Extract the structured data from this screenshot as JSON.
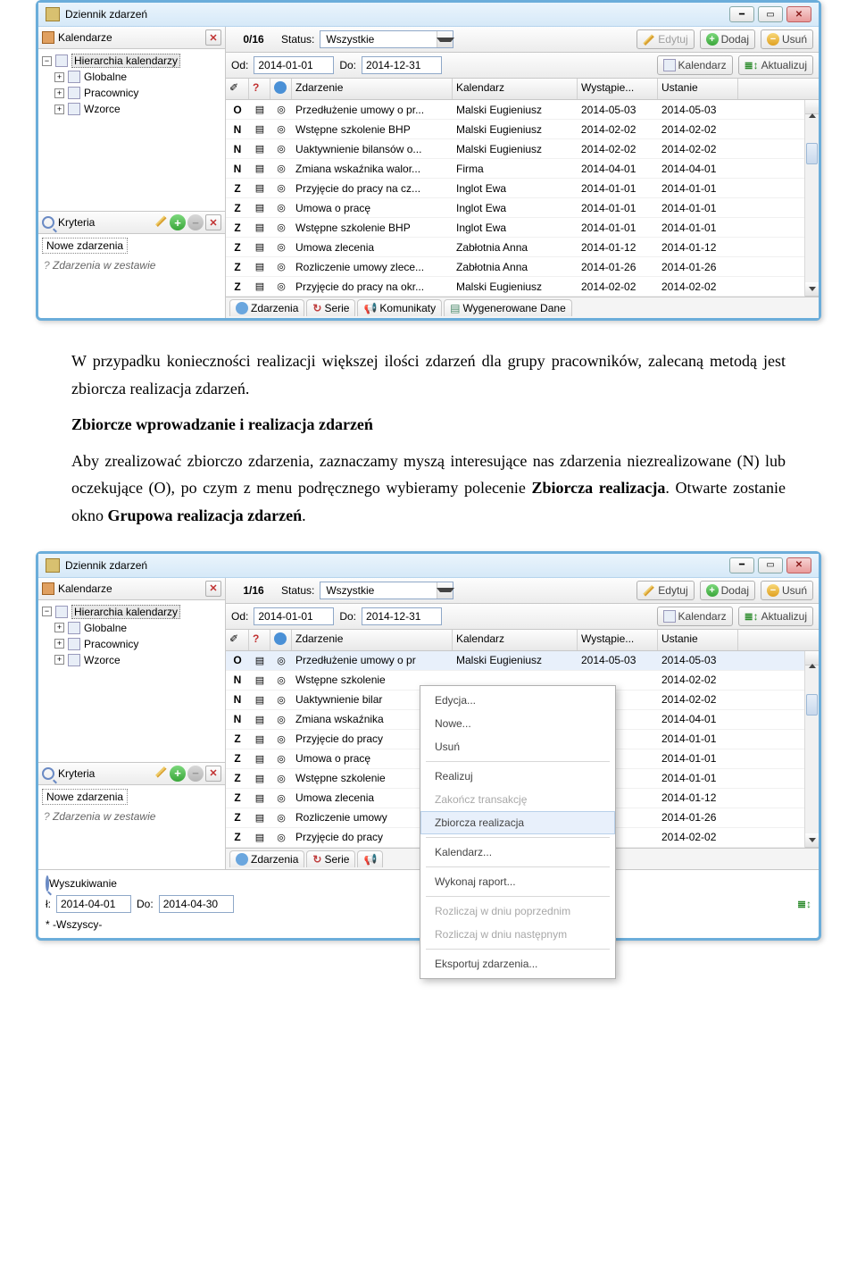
{
  "window_title": "Dziennik zdarzeń",
  "left": {
    "calendars_label": "Kalendarze",
    "tree_root": "Hierarchia kalendarzy",
    "tree_items": [
      "Globalne",
      "Pracownicy",
      "Wzorce"
    ],
    "criteria_label": "Kryteria",
    "criteria_box": "Nowe zdarzenia",
    "criteria_note": "Zdarzenia w zestawie"
  },
  "toolbar": {
    "counter1": "0/16",
    "counter2": "1/16",
    "status_label": "Status:",
    "status_value": "Wszystkie",
    "edit": "Edytuj",
    "add": "Dodaj",
    "del": "Usuń",
    "od": "Od:",
    "do": "Do:",
    "date_from": "2014-01-01",
    "date_to": "2014-12-31",
    "kalendarz": "Kalendarz",
    "aktualizuj": "Aktualizuj"
  },
  "grid": {
    "cols": {
      "c1": "Zdarzenie",
      "c2": "Kalendarz",
      "c3": "Wystąpie...",
      "c4": "Ustanie"
    },
    "rows": [
      {
        "s": "O",
        "ev": "Przedłużenie umowy o pr...",
        "kal": "Malski Eugieniusz",
        "d1": "2014-05-03",
        "d2": "2014-05-03"
      },
      {
        "s": "N",
        "ev": "Wstępne szkolenie BHP",
        "kal": "Malski Eugieniusz",
        "d1": "2014-02-02",
        "d2": "2014-02-02"
      },
      {
        "s": "N",
        "ev": "Uaktywnienie bilansów o...",
        "kal": "Malski Eugieniusz",
        "d1": "2014-02-02",
        "d2": "2014-02-02"
      },
      {
        "s": "N",
        "ev": "Zmiana wskaźnika walor...",
        "kal": "Firma",
        "d1": "2014-04-01",
        "d2": "2014-04-01"
      },
      {
        "s": "Z",
        "ev": "Przyjęcie do pracy na cz...",
        "kal": "Inglot Ewa",
        "d1": "2014-01-01",
        "d2": "2014-01-01"
      },
      {
        "s": "Z",
        "ev": "Umowa o pracę",
        "kal": "Inglot Ewa",
        "d1": "2014-01-01",
        "d2": "2014-01-01"
      },
      {
        "s": "Z",
        "ev": "Wstępne szkolenie BHP",
        "kal": "Inglot Ewa",
        "d1": "2014-01-01",
        "d2": "2014-01-01"
      },
      {
        "s": "Z",
        "ev": "Umowa zlecenia",
        "kal": "Zabłotnia Anna",
        "d1": "2014-01-12",
        "d2": "2014-01-12"
      },
      {
        "s": "Z",
        "ev": "Rozliczenie umowy zlece...",
        "kal": "Zabłotnia Anna",
        "d1": "2014-01-26",
        "d2": "2014-01-26"
      },
      {
        "s": "Z",
        "ev": "Przyjęcie do pracy na okr...",
        "kal": "Malski Eugieniusz",
        "d1": "2014-02-02",
        "d2": "2014-02-02"
      }
    ],
    "rows2": [
      {
        "s": "O",
        "ev": "Przedłużenie umowy o pr",
        "kal": "Malski Eugieniusz",
        "d1": "2014-05-03",
        "d2": "2014-05-03"
      },
      {
        "s": "N",
        "ev": "Wstępne szkolenie",
        "kal": "",
        "d1": "",
        "d2": "2014-02-02"
      },
      {
        "s": "N",
        "ev": "Uaktywnienie bilar",
        "kal": "",
        "d1": "",
        "d2": "2014-02-02"
      },
      {
        "s": "N",
        "ev": "Zmiana wskaźnika",
        "kal": "",
        "d1": "",
        "d2": "2014-04-01"
      },
      {
        "s": "Z",
        "ev": "Przyjęcie do pracy",
        "kal": "",
        "d1": "",
        "d2": "2014-01-01"
      },
      {
        "s": "Z",
        "ev": "Umowa o pracę",
        "kal": "",
        "d1": "",
        "d2": "2014-01-01"
      },
      {
        "s": "Z",
        "ev": "Wstępne szkolenie",
        "kal": "",
        "d1": "",
        "d2": "2014-01-01"
      },
      {
        "s": "Z",
        "ev": "Umowa zlecenia",
        "kal": "",
        "d1": "",
        "d2": "2014-01-12"
      },
      {
        "s": "Z",
        "ev": "Rozliczenie umowy",
        "kal": "",
        "d1": "",
        "d2": "2014-01-26"
      },
      {
        "s": "Z",
        "ev": "Przyjęcie do pracy",
        "kal": "",
        "d1": "",
        "d2": "2014-02-02"
      }
    ]
  },
  "tabs": {
    "t1": "Zdarzenia",
    "t2": "Serie",
    "t3": "Komunikaty",
    "t4": "Wygenerowane Dane"
  },
  "doc": {
    "p1": "W przypadku konieczności realizacji większej ilości zdarzeń dla grupy pracowników, zalecaną metodą jest zbiorcza realizacja zdarzeń.",
    "h": "Zbiorcze wprowadzanie i realizacja zdarzeń",
    "p2a": "Aby zrealizować zbiorczo zdarzenia, zaznaczamy myszą interesujące nas zdarzenia niezrealizowane (N) lub oczekujące (O), po czym z menu podręcznego wybieramy polecenie ",
    "p2b": "Zbiorcza realizacja",
    "p2c": ". Otwarte zostanie okno ",
    "p2d": "Grupowa realizacja zdarzeń",
    "p2e": "."
  },
  "ctx": {
    "i1": "Edycja...",
    "i2": "Nowe...",
    "i3": "Usuń",
    "i4": "Realizuj",
    "i5": "Zakończ transakcję",
    "i6": "Zbiorcza realizacja",
    "i7": "Kalendarz...",
    "i8": "Wykonaj raport...",
    "i9": "Rozliczaj w dniu poprzednim",
    "i10": "Rozliczaj w dniu następnym",
    "i11": "Eksportuj zdarzenia..."
  },
  "search": {
    "label": "Wyszukiwanie",
    "od": "2014-04-01",
    "do": "2014-04-30",
    "who": "-Wszyscy-"
  }
}
